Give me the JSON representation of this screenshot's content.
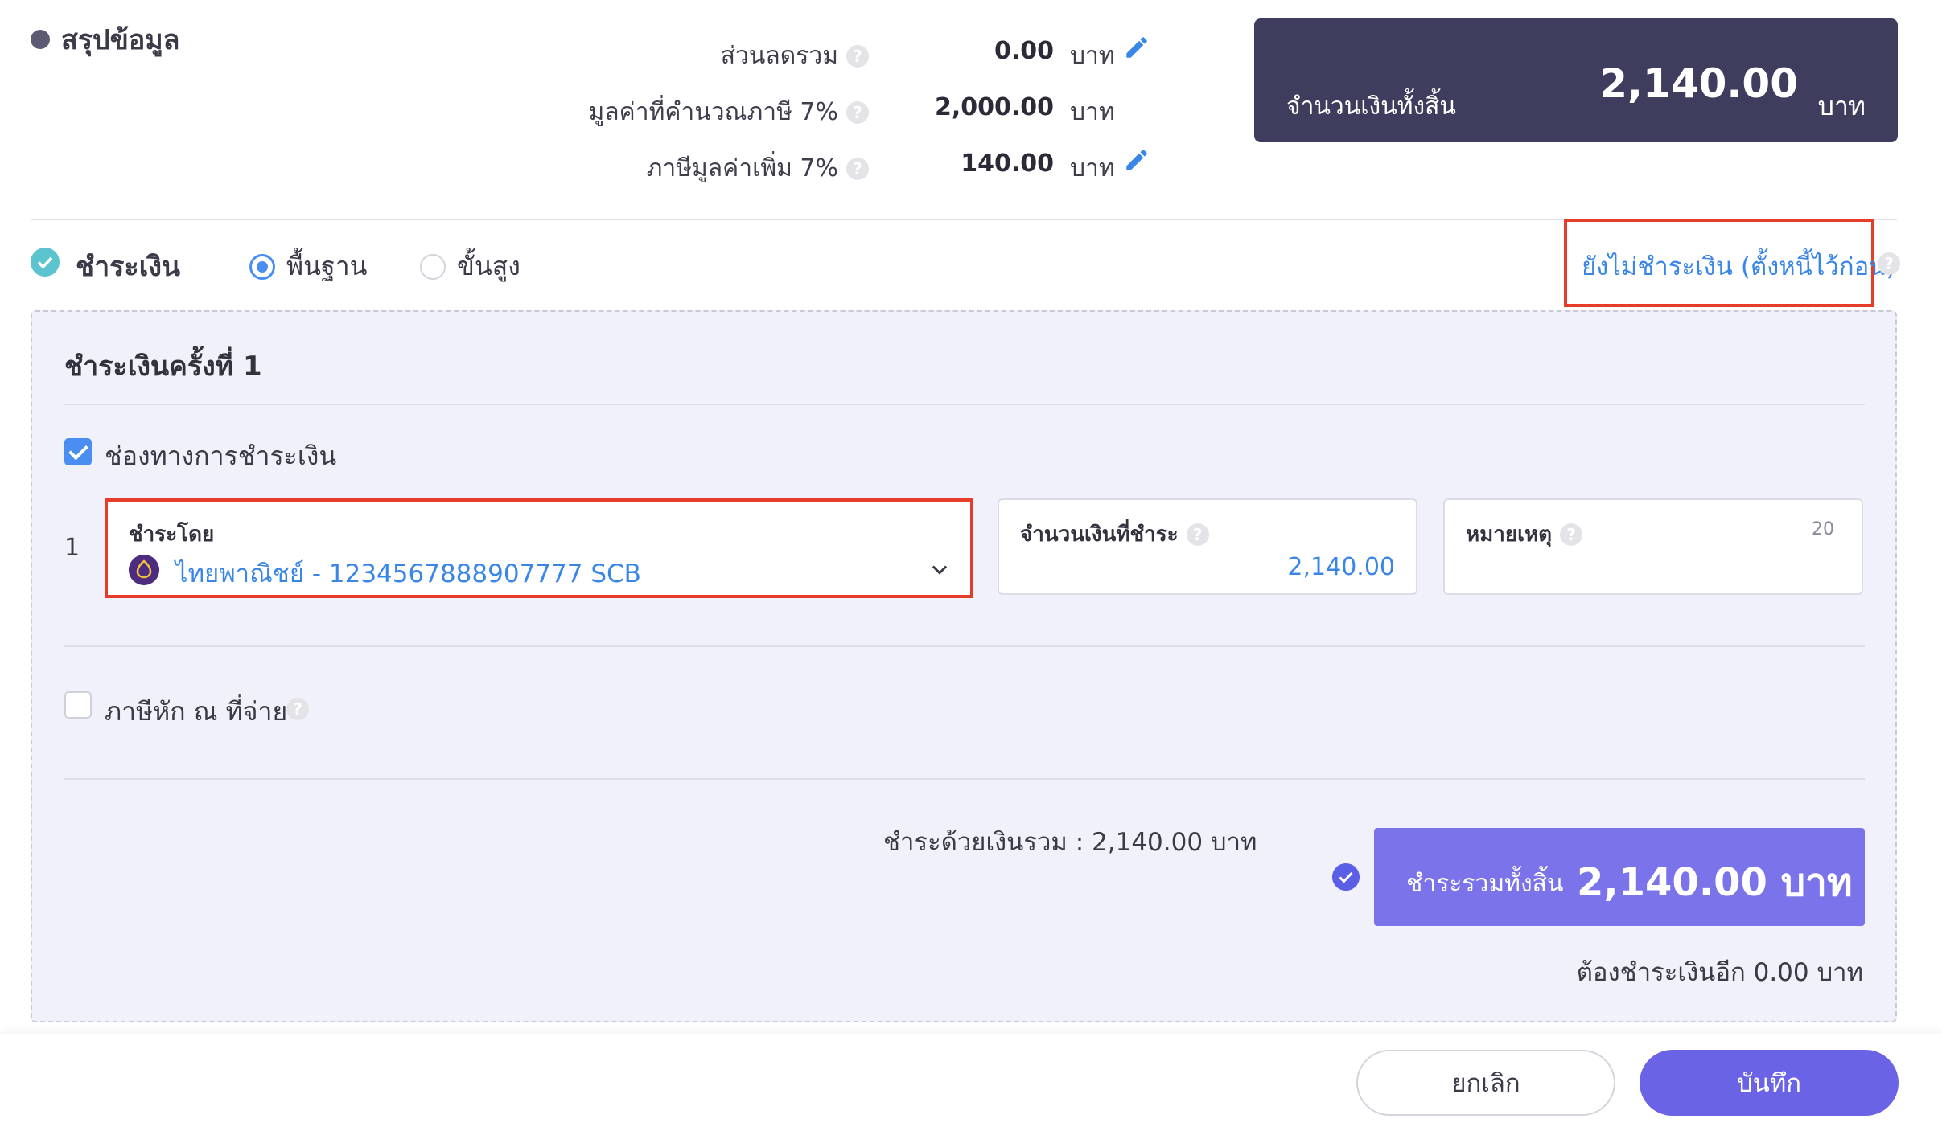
{
  "summary": {
    "title": "สรุปข้อมูล",
    "discount": {
      "label": "ส่วนลดรวม",
      "value": "0.00",
      "unit": "บาท"
    },
    "taxable": {
      "label": "มูลค่าที่คำนวณภาษี 7%",
      "value": "2,000.00",
      "unit": "บาท"
    },
    "vat": {
      "label": "ภาษีมูลค่าเพิ่ม 7%",
      "value": "140.00",
      "unit": "บาท"
    },
    "total": {
      "label": "จำนวนเงินทั้งสิ้น",
      "value": "2,140.00",
      "unit": "บาท"
    }
  },
  "payment": {
    "title": "ชำระเงิน",
    "mode_basic": "พื้นฐาน",
    "mode_advanced": "ขั้นสูง",
    "selected_mode": "พื้นฐาน",
    "unpaid_link": "ยังไม่ชำระเงิน (ตั้งหนี้ไว้ก่อน)",
    "round_title": "ชำระเงินครั้งที่ 1",
    "channel_label": "ช่องทางการชำระเงิน",
    "channel_checked": true,
    "row_number": "1",
    "pay_by_label": "ชำระโดย",
    "pay_by_value": "ไทยพาณิชย์ - 1234567888907777 SCB",
    "amount_label": "จำนวนเงินที่ชำระ",
    "amount_value": "2,140.00",
    "note_label": "หมายเหตุ",
    "note_counter": "20",
    "wht_label": "ภาษีหัก ณ ที่จ่าย",
    "wht_checked": false,
    "paid_sum_text": "ชำระด้วยเงินรวม :  2,140.00 บาท",
    "grand_label": "ชำระรวมทั้งสิ้น",
    "grand_value": "2,140.00 บาท",
    "remaining_text": "ต้องชำระเงินอีก 0.00 บาท"
  },
  "footer": {
    "cancel_label": "ยกเลิก",
    "save_label": "บันทึก"
  },
  "colors": {
    "accent": "#4a8ef2",
    "dark_panel": "#3e3d5e",
    "purple": "#6b63e6",
    "highlight": "#e63c2a"
  }
}
